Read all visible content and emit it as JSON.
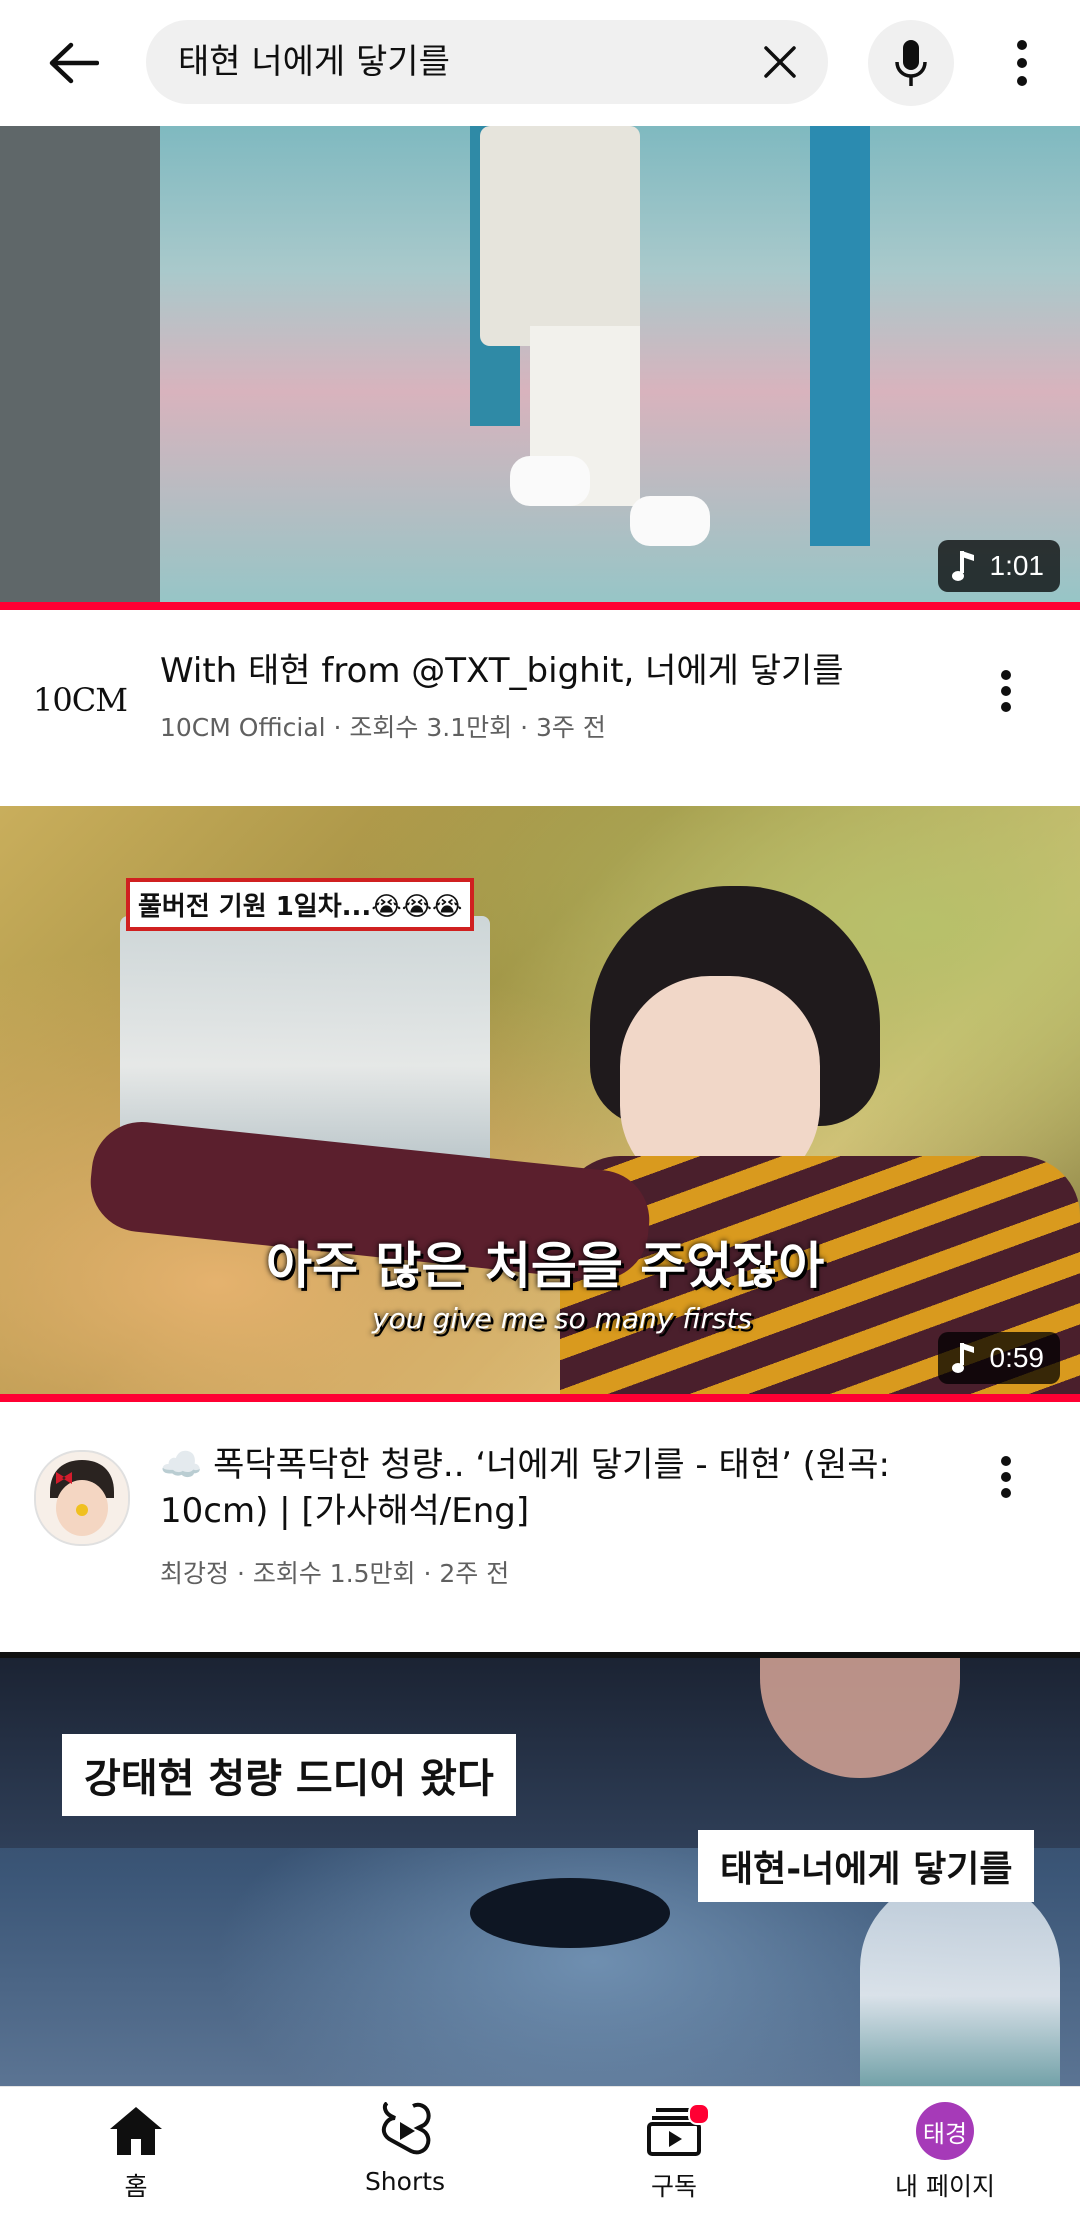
{
  "search": {
    "query": "태현 너에게 닿기를"
  },
  "videos": [
    {
      "duration": "1:01",
      "progress": 1.0,
      "channel_logo_text": "10CM",
      "title": "With 태현 from @TXT_bighit, 너에게 닿기를",
      "meta": "10CM Official · 조회수 3.1만회 · 3주 전"
    },
    {
      "duration": "0:59",
      "progress": 1.0,
      "thumb_tag": "풀버전 기원 1일차...😭😭😭",
      "thumb_subtitle_ko": "아주 많은 처음을 주었잖아",
      "thumb_subtitle_en": "you give me so many firsts",
      "title": "☁️ 폭닥폭닥한 청량.. ‘너에게 닿기를 - 태현’ (원곡: 10cm) | [가사해석/Eng]",
      "meta": "최강정 · 조회수 1.5만회 · 2주 전"
    },
    {
      "thumb_caption_left": "강태현 청량 드디어 왔다",
      "thumb_caption_right": "태현-너에게 닿기를"
    }
  ],
  "nav": {
    "home": "홈",
    "shorts": "Shorts",
    "subscriptions": "구독",
    "profile_avatar": "태경",
    "profile": "내 페이지"
  },
  "colors": {
    "accent": "#ff0033",
    "avatar_bg": "#a63ab8"
  }
}
